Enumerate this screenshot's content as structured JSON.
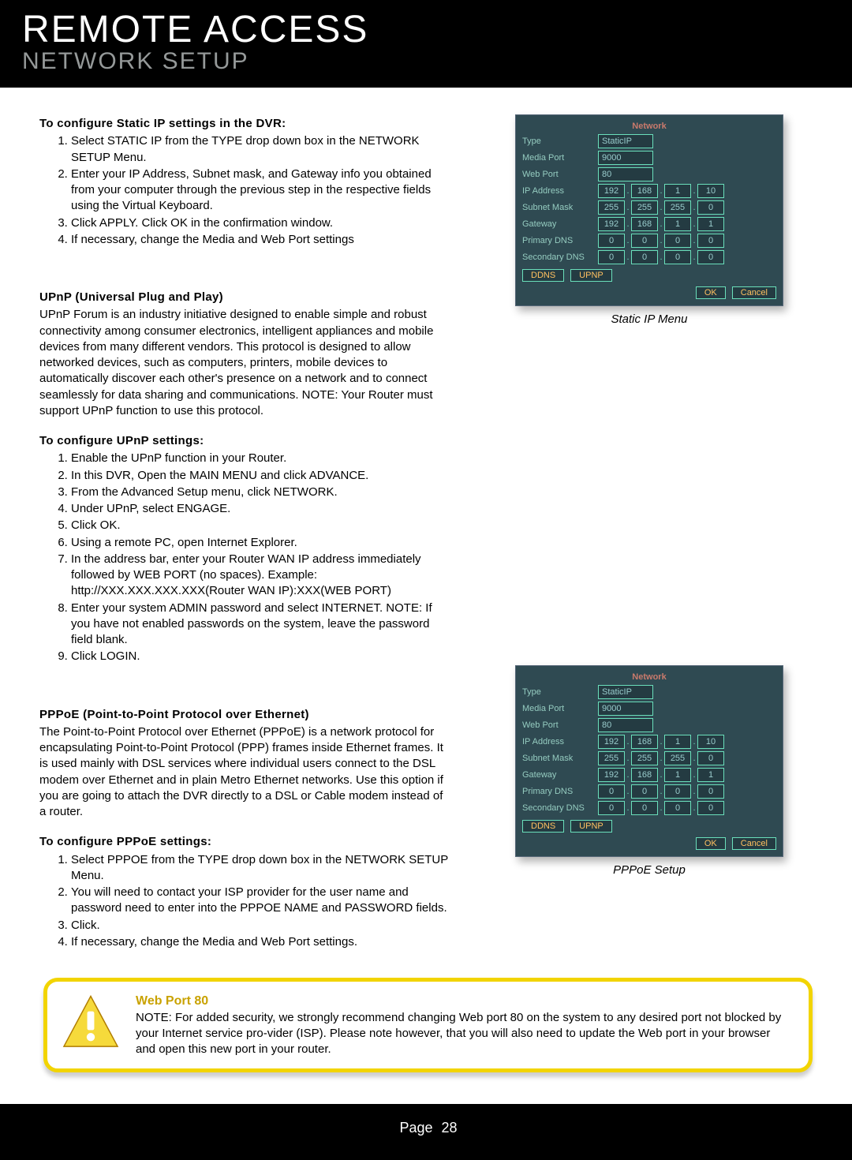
{
  "header": {
    "title": "REMOTE ACCESS",
    "subtitle": "NETWORK SETUP"
  },
  "sec1": {
    "title": "To configure Static IP settings in the DVR:",
    "items": [
      "Select STATIC IP from the TYPE drop down box in the NETWORK SETUP Menu.",
      "Enter your IP Address, Subnet mask, and Gateway info you obtained from your computer through the previous step in the respective fields using the Virtual Keyboard.",
      "Click APPLY. Click OK in the confirmation window.",
      "If necessary, change the Media and Web Port settings"
    ]
  },
  "upnp": {
    "title": "UPnP (Universal Plug and Play)",
    "para": "UPnP Forum is an industry initiative designed to enable simple and robust connectivity among consumer electronics, intelligent appliances and mobile devices from many different vendors. This protocol is designed to allow networked devices, such as computers, printers, mobile devices to automatically discover each other's presence on a network and to connect seamlessly for data sharing and communications. NOTE: Your Router must support UPnP function to use this protocol.",
    "subtitle": "To configure UPnP settings:",
    "items": [
      "Enable the UPnP function in your Router.",
      "In this DVR, Open the MAIN MENU and click ADVANCE.",
      "From the Advanced Setup menu, click NETWORK.",
      "Under UPnP, select ENGAGE.",
      "Click OK.",
      "Using a remote PC, open Internet Explorer.",
      "In the address bar, enter your Router WAN IP address immediately followed by WEB PORT (no spaces). Example: http://XXX.XXX.XXX.XXX(Router WAN IP):XXX(WEB PORT)",
      "Enter your system ADMIN password and select INTERNET. NOTE: If you have not enabled passwords on the system, leave the password field blank.",
      "Click LOGIN."
    ]
  },
  "pppoe": {
    "title": "PPPoE (Point-to-Point Protocol over Ethernet)",
    "para": "The Point-to-Point Protocol over Ethernet (PPPoE) is a network protocol for encapsulating Point-to-Point Protocol (PPP) frames inside Ethernet frames. It is used mainly with DSL services where individual users connect to the DSL modem over Ethernet and in plain Metro Ethernet networks. Use this option if you are going to attach the DVR directly to a DSL or Cable modem instead of a router.",
    "subtitle": "To configure PPPoE settings:",
    "items": [
      "Select PPPOE from the TYPE drop down box in the NETWORK SETUP Menu.",
      "You will need to contact your ISP provider for the user name and password need to enter into the PPPOE NAME and PASSWORD fields.",
      "Click.",
      "If necessary, change the Media and Web Port settings."
    ]
  },
  "menu": {
    "header": "Network",
    "labels": {
      "type": "Type",
      "media": "Media Port",
      "web": "Web Port",
      "ip": "IP Address",
      "subnet": "Subnet Mask",
      "gateway": "Gateway",
      "pdns": "Primary DNS",
      "sdns": "Secondary DNS"
    },
    "type": "StaticIP",
    "media": "9000",
    "web": "80",
    "ip": [
      "192",
      "168",
      "1",
      "10"
    ],
    "subnet": [
      "255",
      "255",
      "255",
      "0"
    ],
    "gateway": [
      "192",
      "168",
      "1",
      "1"
    ],
    "pdns": [
      "0",
      "0",
      "0",
      "0"
    ],
    "sdns": [
      "0",
      "0",
      "0",
      "0"
    ],
    "btn": {
      "ddns": "DDNS",
      "upnp": "UPNP",
      "ok": "OK",
      "cancel": "Cancel"
    }
  },
  "cap1": "Static IP Menu",
  "cap2": "PPPoE Setup",
  "callout": {
    "title": "Web Port 80",
    "body": "NOTE: For added security, we strongly recommend changing Web port 80 on the system to any desired port not blocked by your Internet service pro-vider (ISP). Please note however, that you will also need to update the Web port in your browser and open this new port in your router."
  },
  "footer": {
    "label": "Page",
    "num": "28"
  }
}
